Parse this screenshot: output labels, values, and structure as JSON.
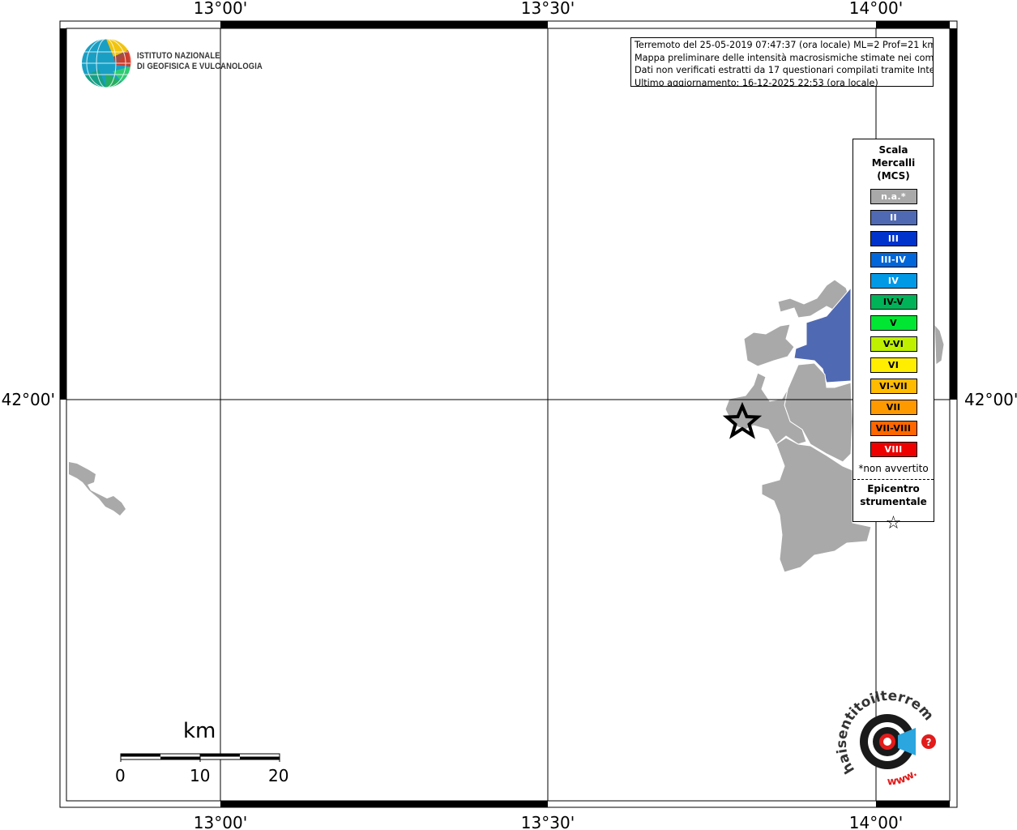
{
  "map": {
    "graticule": {
      "lon_labels": [
        "13°00'",
        "13°30'",
        "14°00'"
      ],
      "lat_labels": [
        "42°00'"
      ]
    }
  },
  "info": {
    "line1": "Terremoto del 25-05-2019 07:47:37 (ora locale) ML=2 Prof=21 km",
    "line2": "Mappa preliminare delle intensità macrosismiche stimate nei comuni",
    "line3": "Dati non verificati estratti da 17 questionari compilati tramite Internet.",
    "line4": "Ultimo aggiornamento: 16-12-2025 22:53 (ora locale)"
  },
  "logo": {
    "line1": "ISTITUTO NAZIONALE",
    "line2": "DI GEOFISICA E VULCANOLOGIA"
  },
  "legend": {
    "title": "Scala\nMercalli\n(MCS)",
    "items": [
      {
        "label": "n.a.*",
        "color": "#a9a9a9",
        "text_color": "#ffffff"
      },
      {
        "label": "II",
        "color": "#5069b3",
        "text_color": "#ffffff"
      },
      {
        "label": "III",
        "color": "#0033cc",
        "text_color": "#ffffff"
      },
      {
        "label": "III-IV",
        "color": "#0066d9",
        "text_color": "#ffffff"
      },
      {
        "label": "IV",
        "color": "#0099e6",
        "text_color": "#ffffff"
      },
      {
        "label": "IV-V",
        "color": "#00b359",
        "text_color": "#000000"
      },
      {
        "label": "V",
        "color": "#00e633",
        "text_color": "#000000"
      },
      {
        "label": "V-VI",
        "color": "#bff000",
        "text_color": "#000000"
      },
      {
        "label": "VI",
        "color": "#ffee00",
        "text_color": "#000000"
      },
      {
        "label": "VI-VII",
        "color": "#ffbb00",
        "text_color": "#000000"
      },
      {
        "label": "VII",
        "color": "#ff9900",
        "text_color": "#000000"
      },
      {
        "label": "VII-VIII",
        "color": "#ff6600",
        "text_color": "#000000"
      },
      {
        "label": "VIII",
        "color": "#ee0000",
        "text_color": "#ffffff"
      }
    ],
    "note": "*non avvertito",
    "epicenter_label": "Epicentro\nstrumentale",
    "epicenter_symbol": "☆"
  },
  "scale_bar": {
    "unit": "km",
    "ticks": [
      "0",
      "10",
      "20"
    ]
  },
  "watermark": {
    "text": "haisentitoilterremoto.it",
    "url_text": "www."
  },
  "colors": {
    "not_felt": "#a9a9a9",
    "intensity_II": "#5069b3"
  }
}
